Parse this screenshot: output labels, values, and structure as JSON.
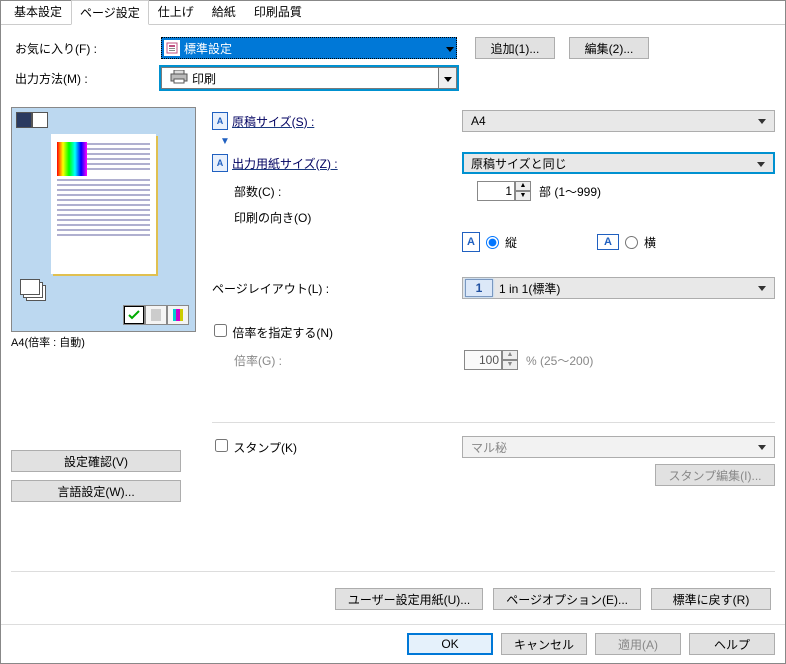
{
  "tabs": [
    "基本設定",
    "ページ設定",
    "仕上げ",
    "給紙",
    "印刷品質"
  ],
  "active_tab_index": 1,
  "favorites": {
    "label": "お気に入り(F) :",
    "value": "標準設定",
    "add_btn": "追加(1)...",
    "edit_btn": "編集(2)..."
  },
  "output_method": {
    "label": "出力方法(M) :",
    "value": "印刷"
  },
  "preview_caption": "A4(倍率 : 自動)",
  "page_size": {
    "label": "原稿サイズ(S) :",
    "value": "A4"
  },
  "output_size": {
    "label": "出力用紙サイズ(Z) :",
    "value": "原稿サイズと同じ"
  },
  "copies": {
    "label": "部数(C) :",
    "value": "1",
    "hint": "部 (1～999)"
  },
  "orientation": {
    "label": "印刷の向き(O)",
    "portrait": "縦",
    "landscape": "横",
    "selected": "portrait"
  },
  "layout": {
    "label": "ページレイアウト(L) :",
    "icon_text": "1",
    "value": "1 in 1(標準)"
  },
  "scale": {
    "checkbox": "倍率を指定する(N)",
    "checked": false,
    "label": "倍率(G) :",
    "value": "100",
    "hint": "% (25～200)"
  },
  "left_buttons": {
    "confirm": "設定確認(V)",
    "lang": "言語設定(W)..."
  },
  "stamp": {
    "checkbox": "スタンプ(K)",
    "value": "マル秘",
    "edit_btn": "スタンプ編集(I)..."
  },
  "lower_buttons": {
    "user_paper": "ユーザー設定用紙(U)...",
    "page_options": "ページオプション(E)...",
    "restore": "標準に戻す(R)"
  },
  "footer": {
    "ok": "OK",
    "cancel": "キャンセル",
    "apply": "適用(A)",
    "help": "ヘルプ"
  }
}
